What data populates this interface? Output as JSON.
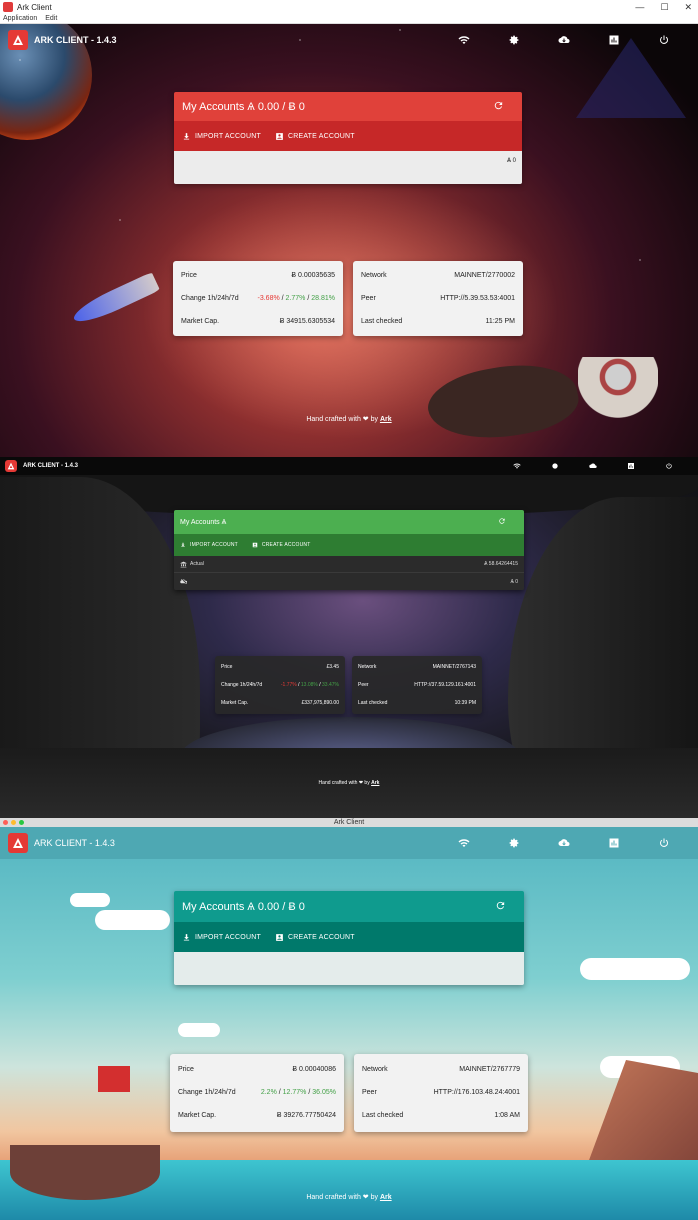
{
  "panel1": {
    "window_title": "Ark Client",
    "window_controls": [
      "—",
      "☐",
      "✕"
    ],
    "menu": [
      "Application",
      "Edit"
    ],
    "app_name": "ARK CLIENT - 1.4.3",
    "accounts_title": "My Accounts Ѧ 0.00 / Ƀ 0",
    "import_label": "IMPORT ACCOUNT",
    "create_label": "CREATE ACCOUNT",
    "accounts_row_value": "Ѧ 0",
    "price_label": "Price",
    "price_value": "Ƀ 0.00035635",
    "change_label": "Change 1h/24h/7d",
    "change_1h": "-3.68%",
    "change_24h": "2.77%",
    "change_7d": "28.81%",
    "cap_label": "Market Cap.",
    "cap_value": "Ƀ 34915.6305534",
    "network_label": "Network",
    "network_value": "MAINNET/2770002",
    "peer_label": "Peer",
    "peer_value": "HTTP://5.39.53.53:4001",
    "checked_label": "Last checked",
    "checked_value": "11:25 PM",
    "footer_text": "Hand crafted with ❤ by",
    "footer_link": "Ark",
    "colors": {
      "accent": "#e0413a",
      "accent_dark": "#c62828"
    }
  },
  "panel2": {
    "app_name": "ARK CLIENT - 1.4.3",
    "accounts_title": "My Accounts Ѧ",
    "import_label": "IMPORT ACCOUNT",
    "create_label": "CREATE ACCOUNT",
    "row1_label": "Actual",
    "row1_value": "Ѧ 58.64264415",
    "row2_value": "Ѧ 0",
    "price_label": "Price",
    "price_value": "£3.45",
    "change_label": "Change 1h/24h/7d",
    "change_1h": "-1.77%",
    "change_24h": "13.08%",
    "change_7d": "33.47%",
    "cap_label": "Market Cap.",
    "cap_value": "£337,975,890.00",
    "network_label": "Network",
    "network_value": "MAINNET/2767143",
    "peer_label": "Peer",
    "peer_value": "HTTP://37.59.129.161:4001",
    "checked_label": "Last checked",
    "checked_value": "10:39 PM",
    "footer_text": "Hand crafted with ❤ by",
    "footer_link": "Ark",
    "colors": {
      "accent": "#4caf50",
      "accent_dark": "#2e7d32"
    }
  },
  "panel3": {
    "window_title": "Ark Client",
    "app_name": "ARK CLIENT - 1.4.3",
    "accounts_title": "My Accounts Ѧ 0.00 / Ƀ 0",
    "import_label": "IMPORT ACCOUNT",
    "create_label": "CREATE ACCOUNT",
    "price_label": "Price",
    "price_value": "Ƀ 0.00040086",
    "change_label": "Change 1h/24h/7d",
    "change_1h": "2.2%",
    "change_24h": "12.77%",
    "change_7d": "36.05%",
    "cap_label": "Market Cap.",
    "cap_value": "Ƀ 39276.77750424",
    "network_label": "Network",
    "network_value": "MAINNET/2767779",
    "peer_label": "Peer",
    "peer_value": "HTTP://176.103.48.24:4001",
    "checked_label": "Last checked",
    "checked_value": "1:08 AM",
    "footer_text": "Hand crafted with ❤ by",
    "footer_link": "Ark",
    "colors": {
      "accent": "#0f9b8e",
      "accent_dark": "#00796b"
    }
  },
  "icons": [
    "wifi-icon",
    "gear-icon",
    "cloud-download-icon",
    "chart-icon",
    "power-icon",
    "refresh-icon",
    "download-icon",
    "account-box-icon",
    "bank-icon",
    "cloud-off-icon"
  ]
}
